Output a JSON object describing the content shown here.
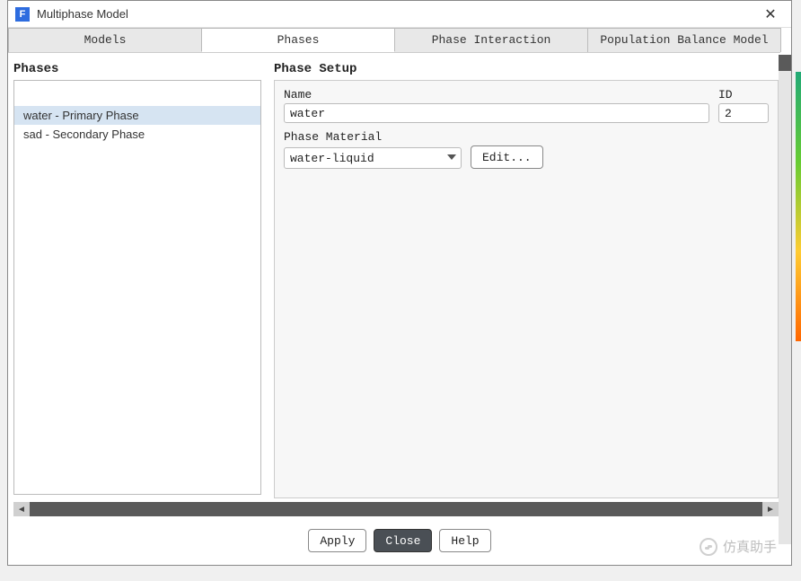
{
  "window": {
    "title": "Multiphase Model",
    "app_icon_letter": "F"
  },
  "tabs": [
    {
      "label": "Models",
      "active": false
    },
    {
      "label": "Phases",
      "active": true
    },
    {
      "label": "Phase Interaction",
      "active": false
    },
    {
      "label": "Population Balance Model",
      "active": false
    }
  ],
  "left": {
    "title": "Phases",
    "items": [
      {
        "label": "water - Primary Phase",
        "selected": true
      },
      {
        "label": "sad - Secondary Phase",
        "selected": false
      }
    ]
  },
  "right": {
    "title": "Phase Setup",
    "name_label": "Name",
    "name_value": "water",
    "id_label": "ID",
    "id_value": "2",
    "material_label": "Phase Material",
    "material_value": "water-liquid",
    "edit_label": "Edit..."
  },
  "footer": {
    "apply": "Apply",
    "close": "Close",
    "help": "Help"
  },
  "watermark": "仿真助手"
}
